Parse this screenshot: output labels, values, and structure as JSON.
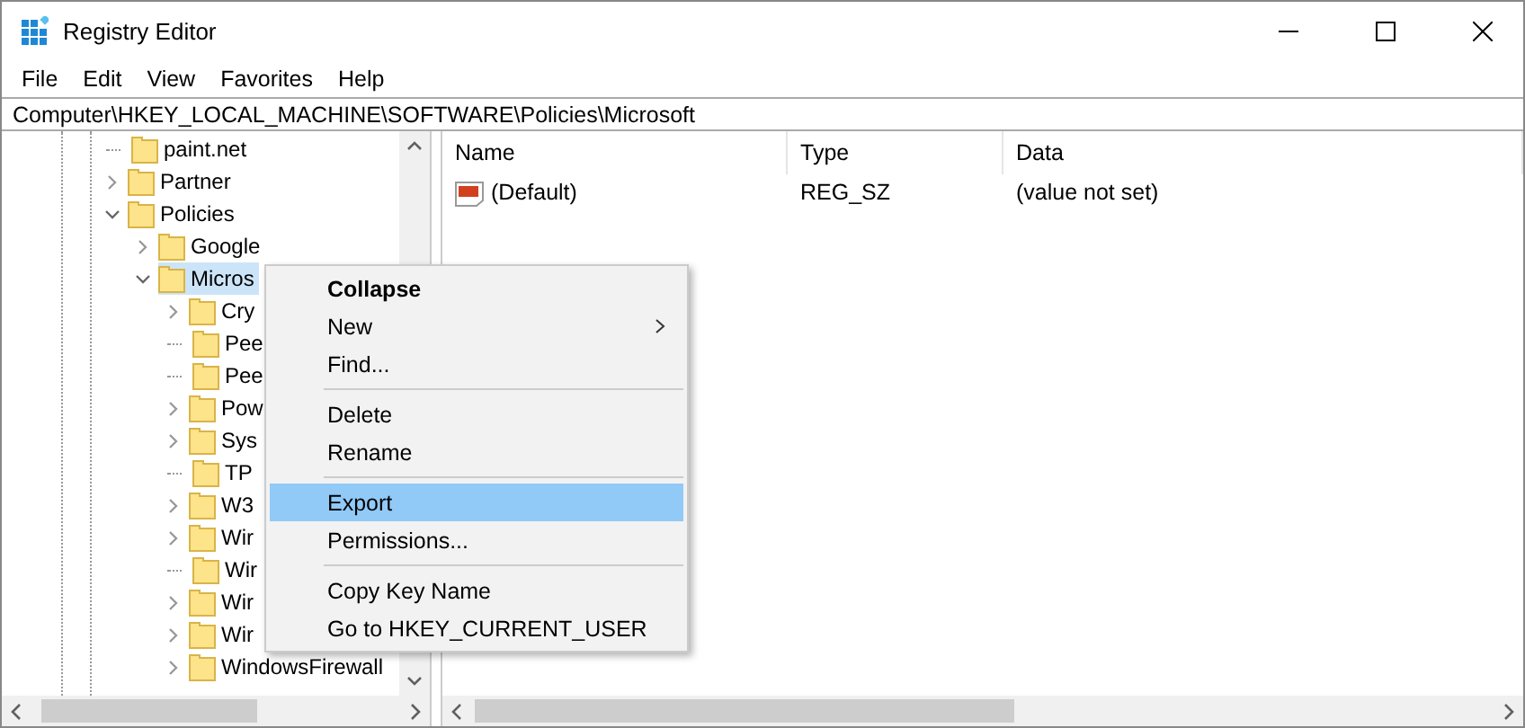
{
  "window": {
    "title": "Registry Editor"
  },
  "menu_bar": [
    "File",
    "Edit",
    "View",
    "Favorites",
    "Help"
  ],
  "address_bar": {
    "value": "Computer\\HKEY_LOCAL_MACHINE\\SOFTWARE\\Policies\\Microsoft"
  },
  "tree": [
    {
      "kind": "leaf",
      "label": "paint.net",
      "selected": false
    },
    {
      "kind": "folder",
      "label": "Partner",
      "expanded": false,
      "selected": false
    },
    {
      "kind": "folder",
      "label": "Policies",
      "expanded": true,
      "selected": false,
      "children": [
        {
          "kind": "folder",
          "label": "Google",
          "expanded": false,
          "selected": false
        },
        {
          "kind": "folder",
          "label": "Micros",
          "expanded": true,
          "selected": true,
          "children": [
            {
              "kind": "folder",
              "label": "Cry",
              "expanded": false,
              "selected": false
            },
            {
              "kind": "leaf",
              "label": "Pee",
              "selected": false
            },
            {
              "kind": "leaf",
              "label": "Pee",
              "selected": false
            },
            {
              "kind": "folder",
              "label": "Pow",
              "expanded": false,
              "selected": false
            },
            {
              "kind": "folder",
              "label": "Sys",
              "expanded": false,
              "selected": false
            },
            {
              "kind": "leaf",
              "label": "TP",
              "selected": false
            },
            {
              "kind": "folder",
              "label": "W3",
              "expanded": false,
              "selected": false
            },
            {
              "kind": "folder",
              "label": "Wir",
              "expanded": false,
              "selected": false
            },
            {
              "kind": "leaf",
              "label": "Wir",
              "selected": false
            },
            {
              "kind": "folder",
              "label": "Wir",
              "expanded": false,
              "selected": false
            },
            {
              "kind": "folder",
              "label": "Wir",
              "expanded": false,
              "selected": false
            },
            {
              "kind": "folder",
              "label": "WindowsFirewall",
              "expanded": false,
              "selected": false
            }
          ]
        }
      ]
    }
  ],
  "values": {
    "columns": [
      "Name",
      "Type",
      "Data"
    ],
    "rows": [
      {
        "name": "(Default)",
        "type": "REG_SZ",
        "data": "(value not set)"
      }
    ]
  },
  "context_menu": [
    {
      "kind": "default",
      "label": "Collapse",
      "selected": false
    },
    {
      "kind": "submenu",
      "label": "New",
      "selected": false
    },
    {
      "kind": "item",
      "label": "Find...",
      "selected": false
    },
    {
      "kind": "separator"
    },
    {
      "kind": "item",
      "label": "Delete",
      "selected": false
    },
    {
      "kind": "item",
      "label": "Rename",
      "selected": false
    },
    {
      "kind": "separator"
    },
    {
      "kind": "item",
      "label": "Export",
      "selected": true
    },
    {
      "kind": "item",
      "label": "Permissions...",
      "selected": false
    },
    {
      "kind": "separator"
    },
    {
      "kind": "item",
      "label": "Copy Key Name",
      "selected": false
    },
    {
      "kind": "item",
      "label": "Go to HKEY_CURRENT_USER",
      "selected": false
    }
  ]
}
